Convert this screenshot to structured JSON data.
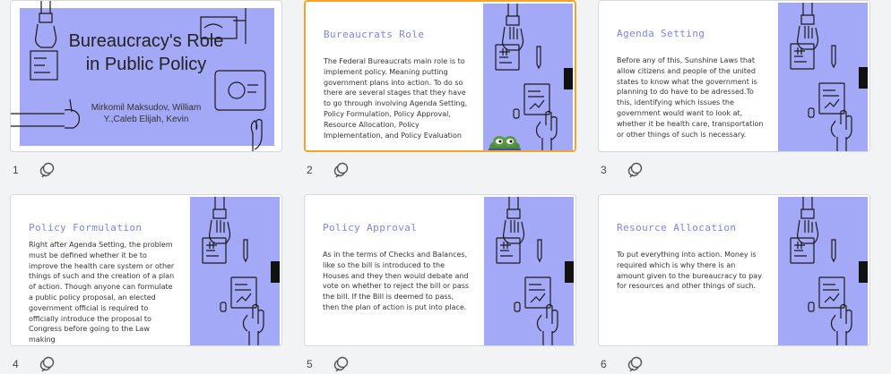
{
  "slides": [
    {
      "number": "1",
      "title": "Bureaucracy's Role in Public Policy",
      "subtitle": "Mirkomil Maksudov, William Y.,Caleb Elijah, Kevin"
    },
    {
      "number": "2",
      "title": "Bureaucrats Role",
      "body": "The Federal Bureaucrats main role is to implement policy. Meaning putting government plans into action. To do so there are several stages that they have to go through involving Agenda Setting, Policy Formulation, Policy Approval, Resource Allocation, Policy Implementation, and Policy Evaluation"
    },
    {
      "number": "3",
      "title": "Agenda Setting",
      "body": "Before any of this,  Sunshine Laws that allow citizens and people of the united states to know what the government is planning to do have to be adressed.To this,  identifying which issues the government would want to look at, whether it be health care, transportation or other things of such is necessary."
    },
    {
      "number": "4",
      "title": "Policy Formulation",
      "body": "Right after Agenda Setting,  the problem must be defined whether it be to improve the health care system or other things of such and the creation of a plan of action. Though anyone can formulate a public policy proposal, an elected government official is required to officially introduce the proposal to Congress before going to the Law making"
    },
    {
      "number": "5",
      "title": "Policy Approval",
      "body": "As in the terms of Checks and Balances, like so the bill is introduced to the Houses and they then would debate and vote on whether to reject the bill or pass the bill. If the Bill is deemed to pass, then the plan of action is put into place."
    },
    {
      "number": "6",
      "title": "Resource Allocation",
      "body": "To put everything into action. Money is required which is why there is an amount given to the bureaucracy to pay for resources and other things of such."
    }
  ],
  "colors": {
    "accent": "#a3a8f7",
    "selected": "#f2a52a",
    "title": "#7b86e0"
  },
  "icons": {
    "comment": "comment-icon"
  }
}
